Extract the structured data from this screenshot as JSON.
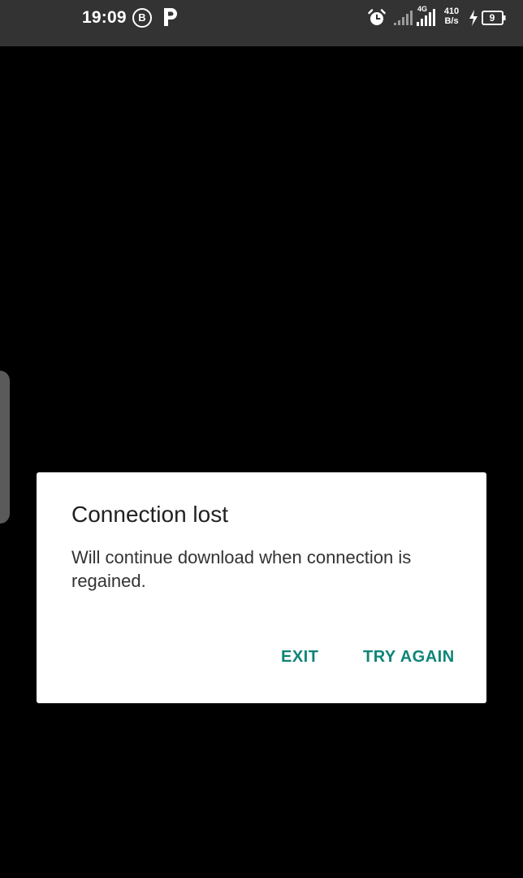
{
  "status_bar": {
    "time": "19:09",
    "badge_letter": "B",
    "net_type": "4G",
    "net_speed_value": "410",
    "net_speed_unit": "B/s",
    "battery_level": "9",
    "icons": [
      "b-badge-icon",
      "parking-p-icon",
      "alarm-icon",
      "signal-bars-icon",
      "signal-4g-icon",
      "charging-bolt-icon",
      "battery-icon"
    ]
  },
  "dialog": {
    "title": "Connection lost",
    "message": "Will continue download when connection is regained.",
    "exit_label": "EXIT",
    "try_again_label": "TRY AGAIN",
    "accent_color": "#0e8577"
  },
  "colors": {
    "background": "#000000",
    "status_bar": "#333333",
    "dialog": "#ffffff",
    "edge_handle": "#5a5a5a"
  }
}
